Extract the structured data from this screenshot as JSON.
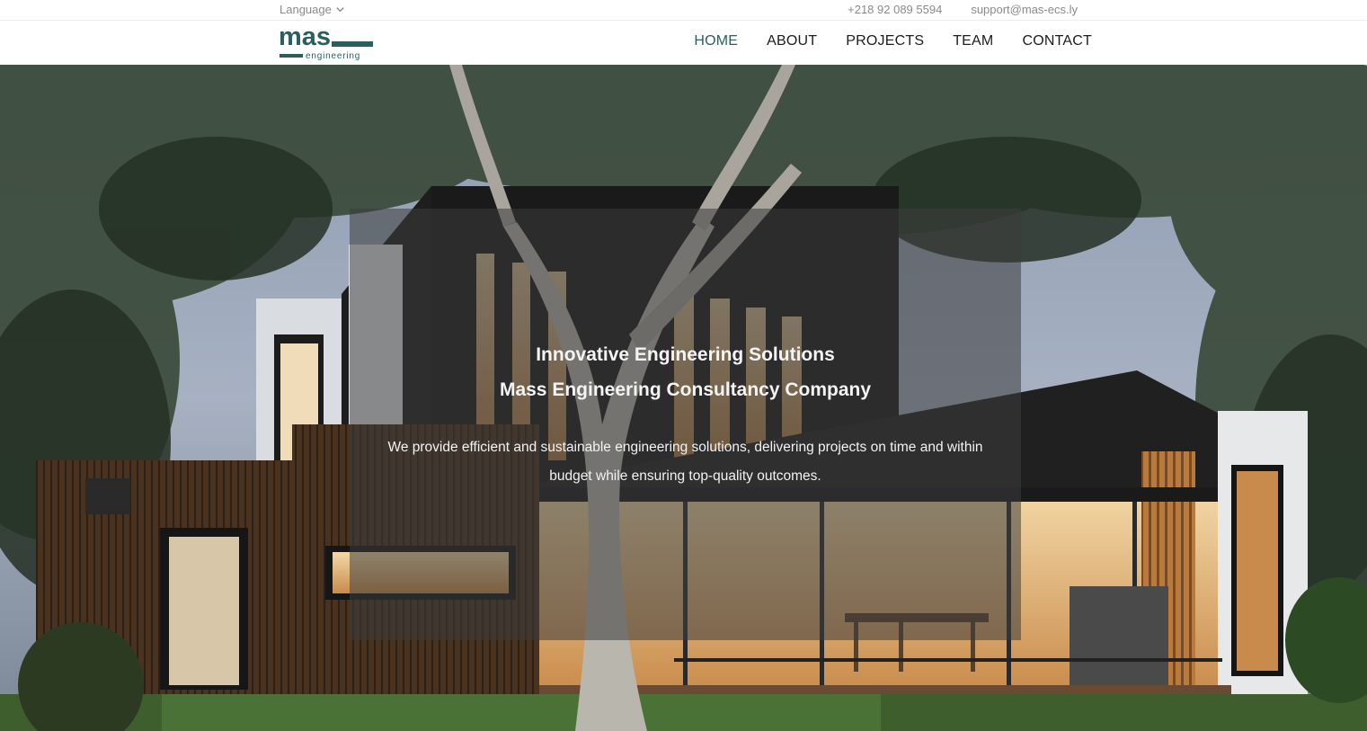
{
  "topbar": {
    "language_label": "Language",
    "phone": "+218 92 089 5594",
    "email": "support@mas-ecs.ly"
  },
  "logo": {
    "main": "mas",
    "sub": "engineering"
  },
  "nav": {
    "items": [
      {
        "label": "HOME",
        "active": true
      },
      {
        "label": "ABOUT",
        "active": false
      },
      {
        "label": "PROJECTS",
        "active": false
      },
      {
        "label": "TEAM",
        "active": false
      },
      {
        "label": "CONTACT",
        "active": false
      }
    ]
  },
  "hero": {
    "title_line1": "Innovative Engineering Solutions",
    "title_line2": "Mass Engineering Consultancy Company",
    "description": "We provide efficient and sustainable engineering solutions, delivering projects on time and within budget while ensuring top-quality outcomes."
  },
  "colors": {
    "brand": "#2a5f5f",
    "nav_text": "#1c1c1c",
    "muted": "#8a8a8a"
  },
  "icons": {
    "language_dropdown": "chevron-down-icon"
  }
}
